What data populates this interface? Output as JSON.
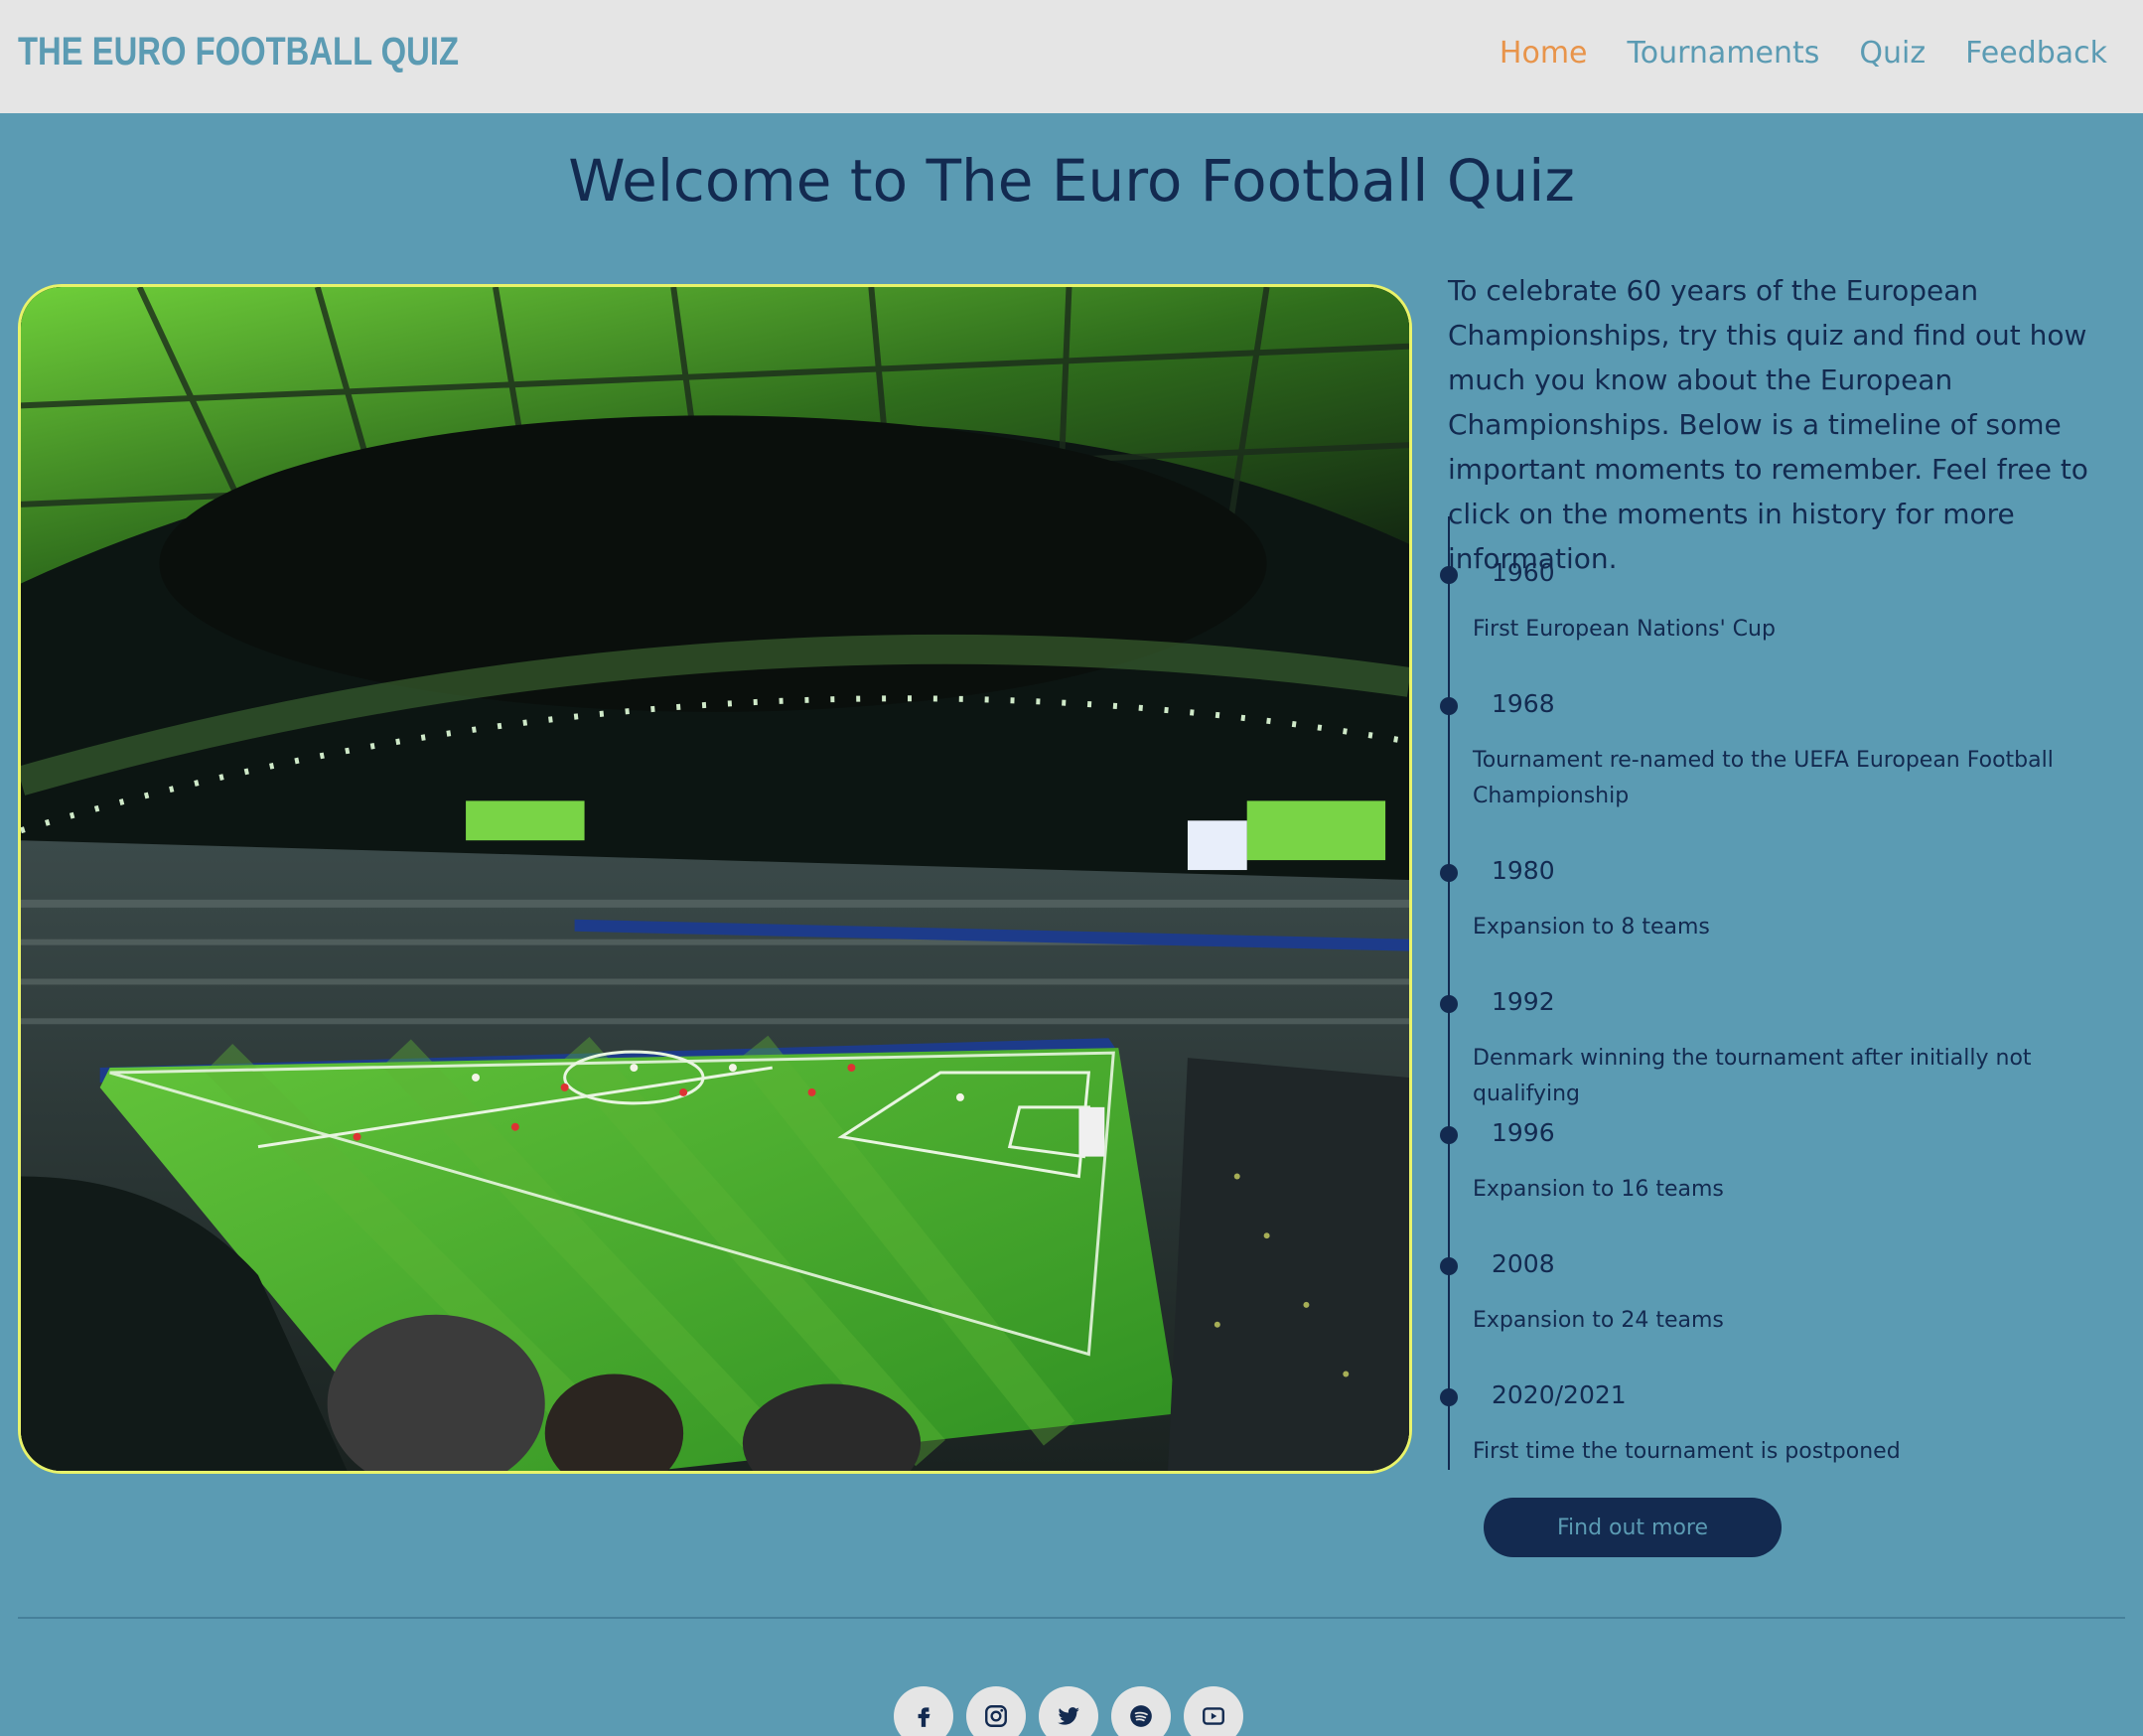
{
  "navbar": {
    "brand": "THE EURO FOOTBALL QUIZ",
    "links": [
      {
        "label": "Home",
        "active": true
      },
      {
        "label": "Tournaments"
      },
      {
        "label": "Quiz"
      },
      {
        "label": "Feedback"
      }
    ]
  },
  "main": {
    "title": "Welcome to The Euro Football Quiz",
    "intro": "To celebrate 60 years of the European Championships, try this quiz and find out how much you know about the European Championships. Below is a timeline of some important moments to remember. Feel free to click on the moments in history for more information.",
    "timeline": [
      {
        "year": "1960",
        "text": "First European Nations' Cup"
      },
      {
        "year": "1968",
        "text": "Tournament re-named to the UEFA European Football Championship"
      },
      {
        "year": "1980",
        "text": "Expansion to 8 teams"
      },
      {
        "year": "1992",
        "text": "Denmark winning the tournament after initially not qualifying"
      },
      {
        "year": "1996",
        "text": "Expansion to 16 teams"
      },
      {
        "year": "2008",
        "text": "Expansion to 24 teams"
      },
      {
        "year": "2020/2021",
        "text": "First time the tournament is postponed"
      }
    ],
    "cta_label": "Find out more"
  },
  "footer": {
    "social_icons": [
      "facebook-icon",
      "instagram-icon",
      "twitter-icon",
      "spotify-icon",
      "youtube-icon"
    ]
  },
  "colors": {
    "background": "#5b9bb3",
    "navbar": "#e5e5e5",
    "brand": "#5b9bb3",
    "active_link": "#e8944a",
    "text_dark": "#132a50",
    "image_border": "#e9f36a"
  }
}
